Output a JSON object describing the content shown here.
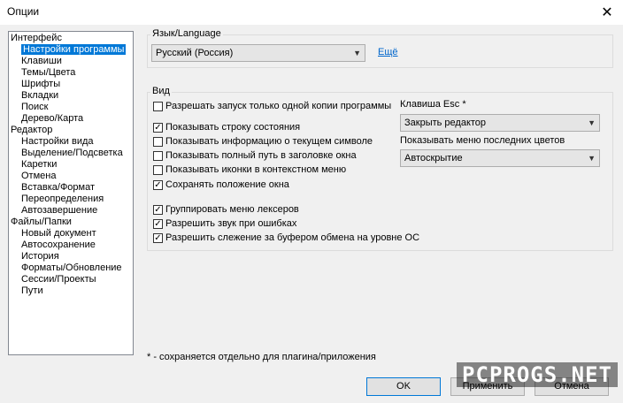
{
  "window": {
    "title": "Опции",
    "close_glyph": "✕"
  },
  "tree": [
    {
      "label": "Интерфейс",
      "level": 0
    },
    {
      "label": "Настройки программы",
      "level": 1,
      "selected": true
    },
    {
      "label": "Клавиши",
      "level": 1
    },
    {
      "label": "Темы/Цвета",
      "level": 1
    },
    {
      "label": "Шрифты",
      "level": 1
    },
    {
      "label": "Вкладки",
      "level": 1
    },
    {
      "label": "Поиск",
      "level": 1
    },
    {
      "label": "Дерево/Карта",
      "level": 1
    },
    {
      "label": "Редактор",
      "level": 0
    },
    {
      "label": "Настройки вида",
      "level": 1
    },
    {
      "label": "Выделение/Подсветка",
      "level": 1
    },
    {
      "label": "Каретки",
      "level": 1
    },
    {
      "label": "Отмена",
      "level": 1
    },
    {
      "label": "Вставка/Формат",
      "level": 1
    },
    {
      "label": "Переопределения",
      "level": 1
    },
    {
      "label": "Автозавершение",
      "level": 1
    },
    {
      "label": "Файлы/Папки",
      "level": 0
    },
    {
      "label": "Новый документ",
      "level": 1
    },
    {
      "label": "Автосохранение",
      "level": 1
    },
    {
      "label": "История",
      "level": 1
    },
    {
      "label": "Форматы/Обновление",
      "level": 1
    },
    {
      "label": "Сессии/Проекты",
      "level": 1
    },
    {
      "label": "Пути",
      "level": 1
    }
  ],
  "language": {
    "group_label": "Язык/Language",
    "selected": "Русский (Россия)",
    "more_link": "Ещё"
  },
  "view": {
    "group_label": "Вид",
    "checkboxes": [
      {
        "label": "Разрешать запуск только одной копии программы",
        "checked": false
      },
      {
        "label": "Показывать строку состояния",
        "checked": true
      },
      {
        "label": "Показывать информацию о текущем символе",
        "checked": false
      },
      {
        "label": "Показывать полный путь в заголовке окна",
        "checked": false
      },
      {
        "label": "Показывать иконки в контекстном меню",
        "checked": false
      },
      {
        "label": "Сохранять положение окна",
        "checked": true
      },
      {
        "label": "Группировать меню лексеров",
        "checked": true
      },
      {
        "label": "Разрешить звук при ошибках",
        "checked": true
      },
      {
        "label": "Разрешить слежение за буфером обмена на уровне ОС",
        "checked": true
      }
    ],
    "esc_label": "Клавиша Esc *",
    "esc_value": "Закрыть редактор",
    "recent_colors_label": "Показывать меню последних цветов",
    "recent_colors_value": "Автоскрытие"
  },
  "footnote": "* - сохраняется отдельно для плагина/приложения",
  "buttons": {
    "ok": "OK",
    "apply": "Применить",
    "cancel": "Отмена"
  },
  "watermark": "PCPROGS.NET",
  "colors": {
    "selection": "#0078d7",
    "link": "#0066cc"
  }
}
